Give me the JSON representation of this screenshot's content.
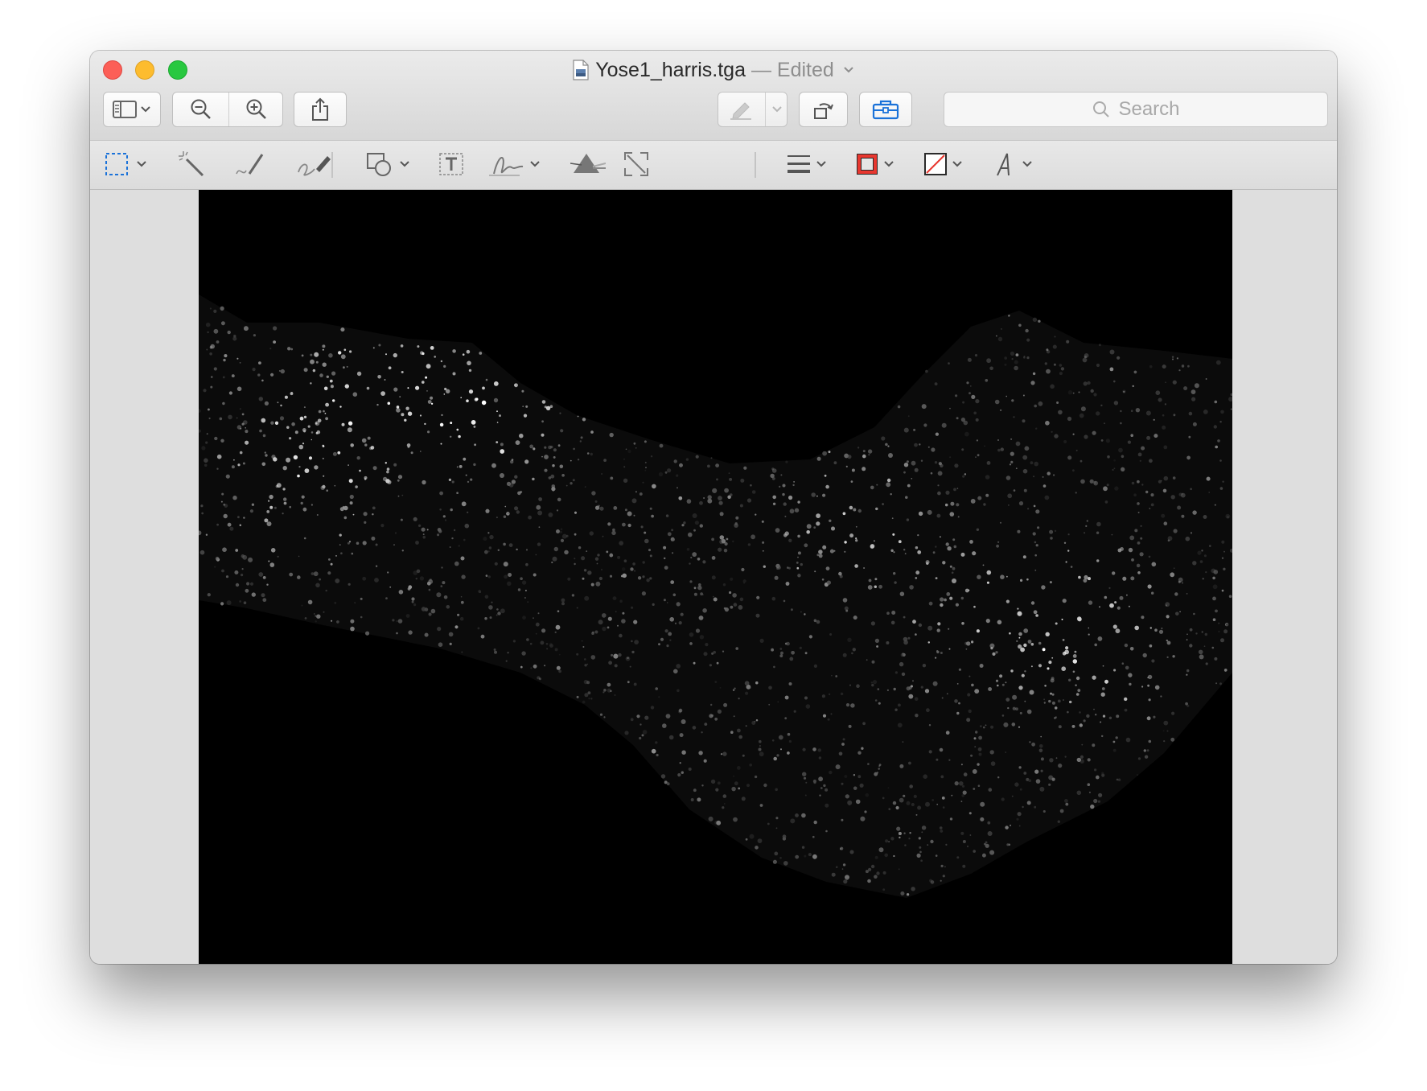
{
  "window": {
    "filename": "Yose1_harris.tga",
    "separator": "—",
    "status": "Edited"
  },
  "toolbar": {
    "search_placeholder": "Search",
    "buttons": [
      "sidebar-toggle",
      "zoom-out",
      "zoom-in",
      "share",
      "highlight",
      "rotate",
      "markup-toolbox"
    ]
  },
  "markup_tools": [
    "rectangular-selection",
    "instant-alpha",
    "sketch",
    "draw",
    "shapes",
    "text",
    "sign",
    "adjust-color",
    "adjust-size",
    "shape-style",
    "border-color",
    "fill-color",
    "text-style"
  ],
  "colors": {
    "border_color": "#e8372f",
    "accent_blue": "#1a72d9",
    "image_background": "#000000"
  },
  "document": {
    "image_description": "Harris corner response map, grayscale"
  }
}
